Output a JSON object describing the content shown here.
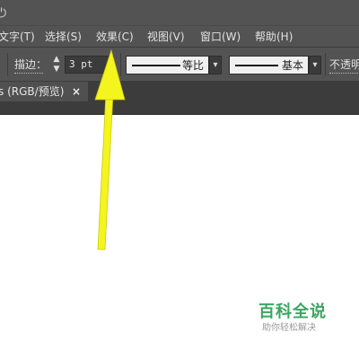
{
  "menu": {
    "items": [
      "文字(T)",
      "选择(S)",
      "效果(C)",
      "视图(V)",
      "窗口(W)",
      "帮助(H)"
    ]
  },
  "control_bar": {
    "stroke_label": "描边：",
    "stroke_value": "3 pt",
    "profile_label": "等比",
    "brush_label": "基本",
    "opacity_label": "不透明",
    "stepper_up": "▲",
    "stepper_down": "▼",
    "dropdown_arrow": "▾"
  },
  "document_tab": {
    "label": "(RGB/预览)",
    "close": "×",
    "prefix": "s"
  },
  "watermark": {
    "title": "百科全说",
    "subtitle": "助你轻松解决"
  },
  "icons": {
    "power": "⏻"
  },
  "colors": {
    "chrome": "#535353",
    "tab_strip": "#3c3c3c",
    "arrow": "#f5f51e",
    "watermark_green": "#3aa561"
  }
}
